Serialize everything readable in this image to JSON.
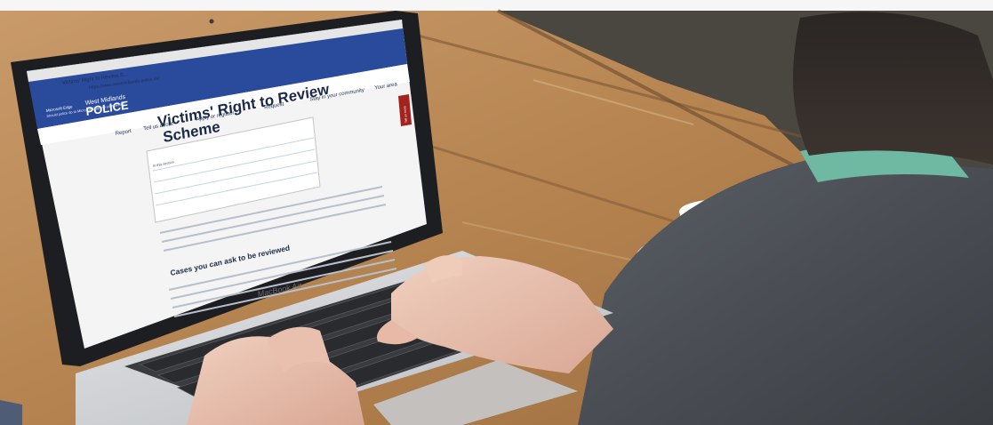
{
  "image": {
    "scene": "person typing on laptop at wooden table with coffee cup",
    "laptop_brand_label": "MacBook Air"
  },
  "screen": {
    "browser_tab_title": "Victims' Right to Review S...",
    "address_bar": "https://www.westmidlands-police.uk/",
    "site_logo_top": "West Midlands",
    "site_logo_bottom": "POLICE",
    "notice_title": "Microsoft Edge",
    "notice_text": "Should police do to Microsoft Edge so your device",
    "nav": [
      "Report",
      "Tell us about",
      "Apply or register",
      "Request",
      "Stay in your community",
      "Your area"
    ],
    "page_title_line1": "Victims' Right to Review",
    "page_title_line2": "Scheme",
    "section_heading": "Cases you can ask to be reviewed",
    "contents_label": "In this section",
    "side_tab": "Tell us more"
  },
  "colors": {
    "wood": "#b98a5c",
    "wood_dark": "#8a6240",
    "laptop_silver": "#cfd1d4",
    "keys": "#2c2d31",
    "site_blue": "#2a4b9b",
    "side_tab_red": "#a3231f"
  }
}
